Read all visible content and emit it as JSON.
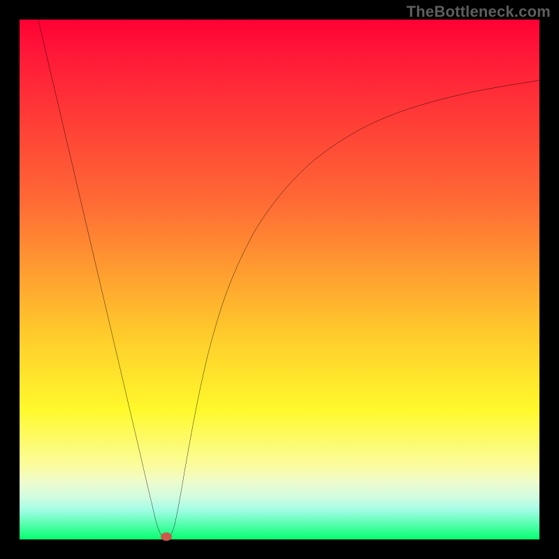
{
  "watermark": "TheBottleneck.com",
  "chart_data": {
    "type": "line",
    "title": "",
    "xlabel": "",
    "ylabel": "",
    "xlim": [
      0,
      100
    ],
    "ylim": [
      0,
      100
    ],
    "grid": false,
    "legend": false,
    "background": "rainbow-vertical-gradient",
    "curve": [
      {
        "x": 3.6,
        "y": 100.0
      },
      {
        "x": 6.0,
        "y": 89.7
      },
      {
        "x": 10.0,
        "y": 72.7
      },
      {
        "x": 14.0,
        "y": 55.6
      },
      {
        "x": 18.0,
        "y": 38.6
      },
      {
        "x": 21.0,
        "y": 25.8
      },
      {
        "x": 23.0,
        "y": 17.3
      },
      {
        "x": 24.5,
        "y": 10.8
      },
      {
        "x": 25.5,
        "y": 6.6
      },
      {
        "x": 26.3,
        "y": 3.3
      },
      {
        "x": 27.0,
        "y": 1.3
      },
      {
        "x": 27.7,
        "y": 0.4
      },
      {
        "x": 28.5,
        "y": 0.3
      },
      {
        "x": 29.3,
        "y": 1.3
      },
      {
        "x": 30.0,
        "y": 3.6
      },
      {
        "x": 31.0,
        "y": 8.8
      },
      {
        "x": 32.0,
        "y": 14.6
      },
      {
        "x": 33.5,
        "y": 22.8
      },
      {
        "x": 35.0,
        "y": 30.2
      },
      {
        "x": 37.0,
        "y": 38.5
      },
      {
        "x": 40.0,
        "y": 48.0
      },
      {
        "x": 44.0,
        "y": 57.0
      },
      {
        "x": 48.0,
        "y": 63.5
      },
      {
        "x": 53.0,
        "y": 69.5
      },
      {
        "x": 58.0,
        "y": 74.0
      },
      {
        "x": 64.0,
        "y": 78.0
      },
      {
        "x": 70.0,
        "y": 81.0
      },
      {
        "x": 77.0,
        "y": 83.5
      },
      {
        "x": 85.0,
        "y": 85.6
      },
      {
        "x": 92.0,
        "y": 87.0
      },
      {
        "x": 100.0,
        "y": 88.3
      }
    ],
    "marker": {
      "x": 28.2,
      "y": 0.5,
      "color": "#cc5a4a"
    }
  }
}
